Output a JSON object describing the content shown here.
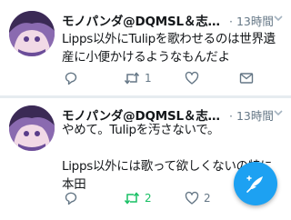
{
  "colors": {
    "accent": "#1da1f2",
    "retweet_active": "#17bf63",
    "secondary_text": "#657786",
    "divider": "#e6ecf0"
  },
  "tweets": [
    {
      "name": "モノパンダ@DQMSL＆志…",
      "time": "· 13時間",
      "lines": [
        "Lipps以外にTulipを歌わせるのは世界遺",
        "産に小便かけるようなもんだよ"
      ],
      "reply_count": "",
      "retweet_count": "1",
      "like_count": "",
      "icons": [
        "reply-icon",
        "retweet-icon",
        "like-icon",
        "share-envelope-icon"
      ]
    },
    {
      "name": "モノパンダ@DQMSL＆志…",
      "time": "· 13時間",
      "lines": [
        "やめて。Tulipを汚さないで。",
        "",
        "Lipps以外には歌って欲しくないの特に",
        "本田"
      ],
      "reply_count": "",
      "retweet_count": "2",
      "like_count": "2",
      "retweeted": true,
      "icons": [
        "reply-icon",
        "retweet-icon",
        "like-icon"
      ]
    }
  ],
  "compose_button": {
    "icon": "feather-compose-icon"
  }
}
